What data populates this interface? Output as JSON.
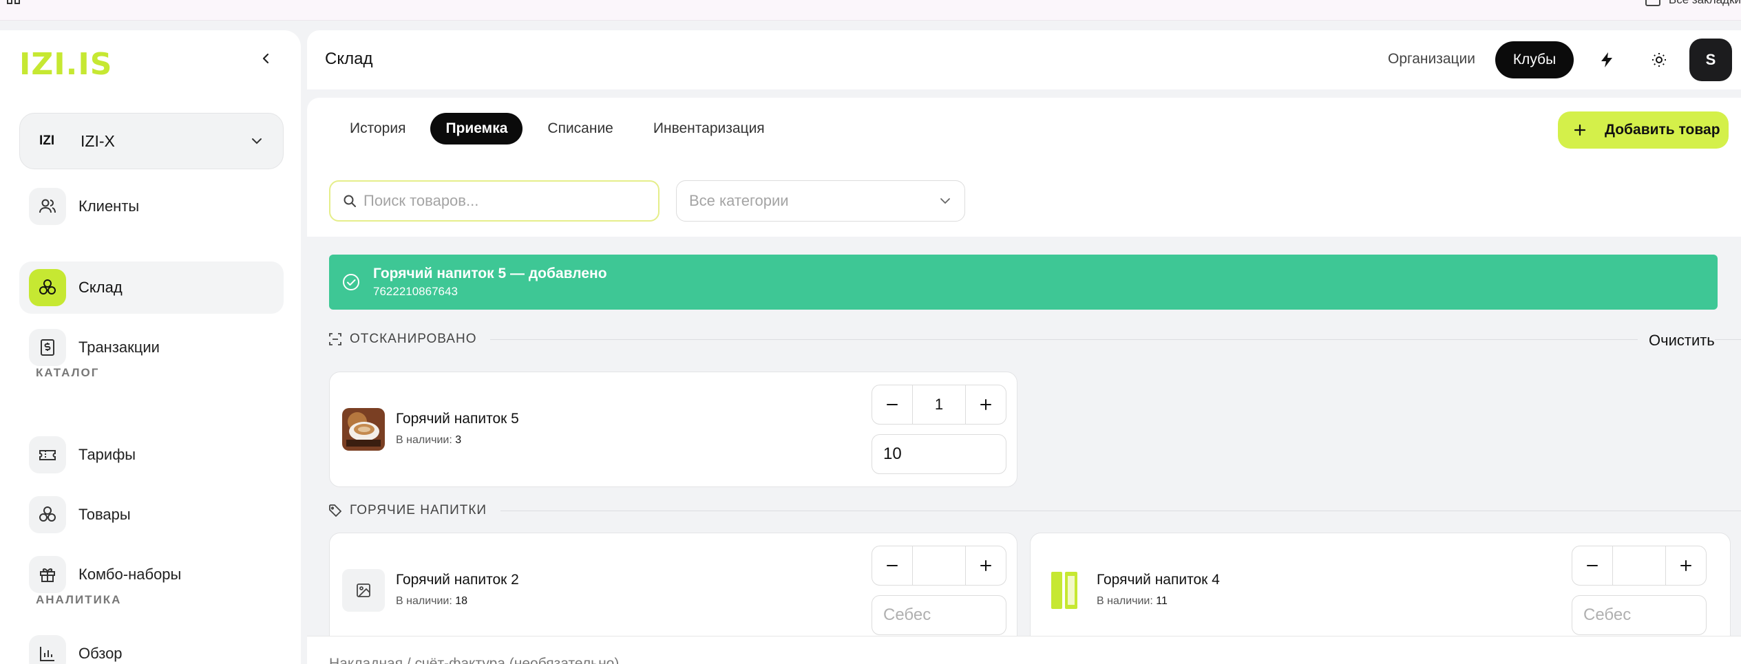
{
  "browser": {
    "bookmarks_label": "Все закладки"
  },
  "sidebar": {
    "logo": "IZI.IS",
    "org": {
      "logo": "IZI",
      "name": "IZI-X"
    },
    "items_top": [
      {
        "label": "Клиенты",
        "icon": "users-icon"
      },
      {
        "label": "Склад",
        "icon": "boxes-icon",
        "active": true
      },
      {
        "label": "Транзакции",
        "icon": "receipt-dollar-icon"
      }
    ],
    "section_catalog": "КАТАЛОГ",
    "items_catalog": [
      {
        "label": "Тарифы",
        "icon": "ticket-icon"
      },
      {
        "label": "Товары",
        "icon": "boxes-icon"
      },
      {
        "label": "Комбо-наборы",
        "icon": "gift-icon"
      }
    ],
    "section_analytics": "АНАЛИТИКА",
    "items_analytics": [
      {
        "label": "Обзор",
        "icon": "bar-chart-icon"
      }
    ]
  },
  "header": {
    "title": "Склад",
    "organizations_link": "Организации",
    "clubs_button": "Клубы",
    "avatar_initial": "S"
  },
  "tabs": [
    {
      "label": "История",
      "active": false
    },
    {
      "label": "Приемка",
      "active": true
    },
    {
      "label": "Списание",
      "active": false
    },
    {
      "label": "Инвентаризация",
      "active": false
    }
  ],
  "add_product_label": "Добавить товар",
  "search": {
    "placeholder": "Поиск товаров..."
  },
  "category_select": {
    "value": "Все категории"
  },
  "banner": {
    "title": "Горячий напиток 5 — добавлено",
    "barcode": "7622210867643"
  },
  "scanned": {
    "title": "ОТСКАНИРОВАНО",
    "clear_label": "Очистить",
    "items": [
      {
        "name": "Горячий напиток 5",
        "stock_label": "В наличии:",
        "stock": "3",
        "qty": "1",
        "cost": "10"
      }
    ]
  },
  "hot_drinks": {
    "title": "ГОРЯЧИЕ НАПИТКИ",
    "items": [
      {
        "name": "Горячий напиток 2",
        "stock_label": "В наличии:",
        "stock": "18",
        "qty": "",
        "cost_placeholder": "Себес"
      },
      {
        "name": "Горячий напиток 4",
        "stock_label": "В наличии:",
        "stock": "11",
        "qty": "",
        "cost_placeholder": "Себес"
      }
    ]
  },
  "invoice_label": "Накладная / счёт-фактура (необязательно)",
  "colors": {
    "accent": "#c6e832",
    "success": "#3ec795",
    "dark": "#0b0b0b"
  }
}
